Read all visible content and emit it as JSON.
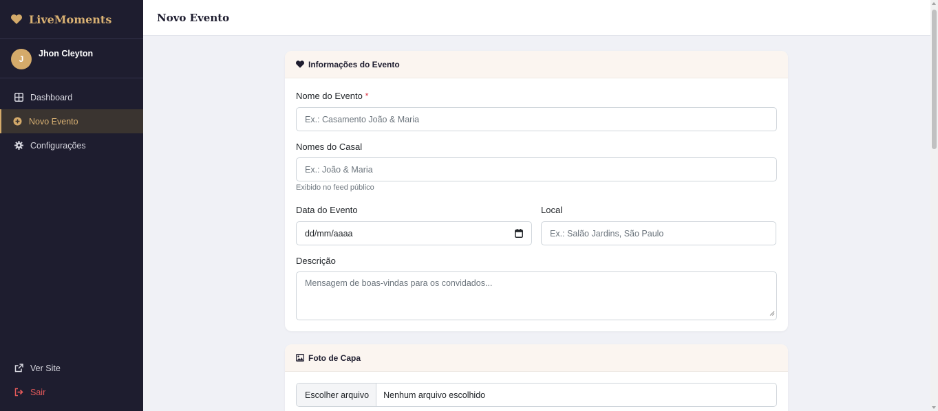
{
  "app": {
    "brand": "LiveMoments"
  },
  "user": {
    "initial": "J",
    "name": "Jhon Cleyton"
  },
  "sidebar": {
    "items": [
      {
        "label": "Dashboard",
        "icon": "grid-icon"
      },
      {
        "label": "Novo Evento",
        "icon": "plus-circle-icon",
        "active": true
      },
      {
        "label": "Configurações",
        "icon": "gear-icon"
      }
    ],
    "bottom": [
      {
        "label": "Ver Site",
        "icon": "external-link-icon"
      },
      {
        "label": "Sair",
        "icon": "logout-icon"
      }
    ]
  },
  "header": {
    "title": "Novo Evento"
  },
  "event_info": {
    "title": "Informações do Evento",
    "name_label": "Nome do Evento",
    "required_mark": "*",
    "name_placeholder": "Ex.: Casamento João & Maria",
    "couple_label": "Nomes do Casal",
    "couple_placeholder": "Ex.: João & Maria",
    "couple_help": "Exibido no feed público",
    "date_label": "Data do Evento",
    "date_value": "dd/mm/aaaa",
    "location_label": "Local",
    "location_placeholder": "Ex.: Salão Jardins, São Paulo",
    "description_label": "Descrição",
    "description_placeholder": "Mensagem de boas-vindas para os convidados..."
  },
  "cover": {
    "title": "Foto de Capa",
    "choose_button": "Escolher arquivo",
    "no_file": "Nenhum arquivo escolhido"
  },
  "colors": {
    "accent": "#d4aa6a",
    "sidebar_bg": "#1e1d2f",
    "danger": "#e45a5a"
  }
}
